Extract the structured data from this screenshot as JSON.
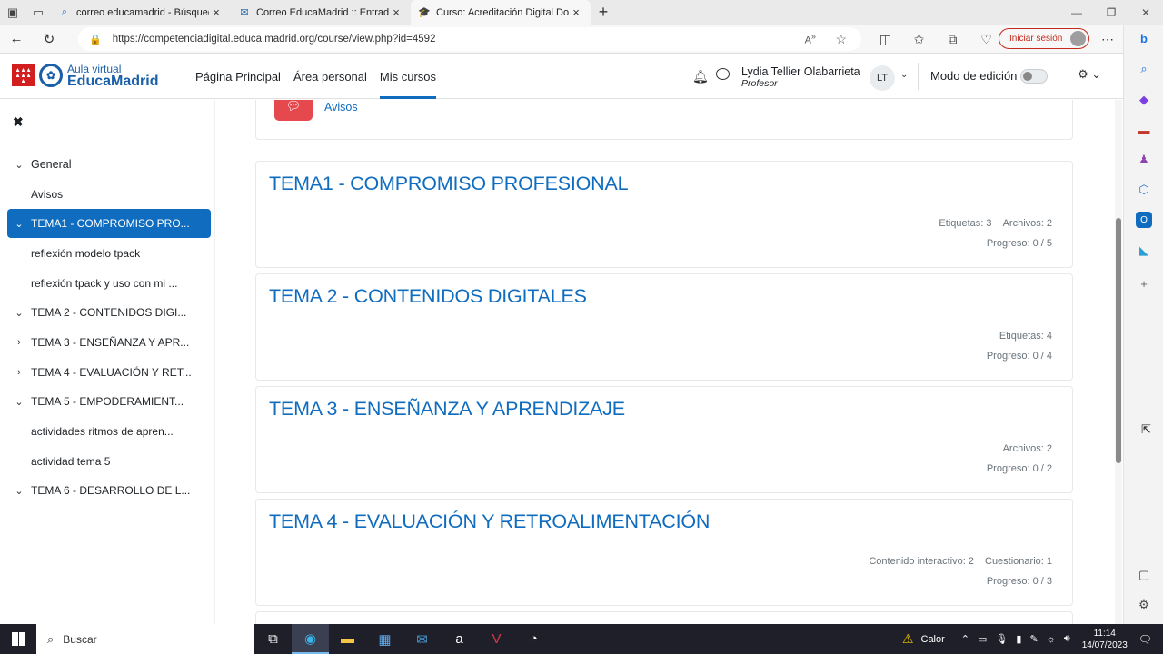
{
  "browser": {
    "tabs": [
      {
        "title": "correo educamadrid - Búsqueda",
        "icon": "search-icon",
        "active": false
      },
      {
        "title": "Correo EducaMadrid :: Entrada",
        "icon": "mail-icon",
        "active": false
      },
      {
        "title": "Curso: Acreditación Digital Doce",
        "icon": "graduation-cap-icon",
        "active": true
      }
    ],
    "url": "https://competenciadigital.educa.madrid.org/course/view.php?id=4592",
    "signin_label": "Iniciar sesión"
  },
  "site": {
    "logo_sub": "Aula virtual",
    "logo_main": "EducaMadrid",
    "nav": [
      {
        "label": "Página Principal",
        "active": false
      },
      {
        "label": "Área personal",
        "active": false
      },
      {
        "label": "Mis cursos",
        "active": true
      }
    ],
    "user": {
      "name": "Lydia Tellier Olabarrieta",
      "role": "Profesor",
      "initials": "LT"
    },
    "edit_mode_label": "Modo de edición"
  },
  "course_index": {
    "items": [
      {
        "label": "General",
        "type": "section",
        "expanded": true
      },
      {
        "label": "Avisos",
        "type": "activity"
      },
      {
        "label": "TEMA1 - COMPROMISO PRO...",
        "type": "section",
        "expanded": true,
        "active": true
      },
      {
        "label": "reflexión modelo tpack",
        "type": "activity"
      },
      {
        "label": "reflexión tpack y uso con mi ...",
        "type": "activity"
      },
      {
        "label": "TEMA 2 - CONTENIDOS DIGI...",
        "type": "section",
        "expanded": true
      },
      {
        "label": "TEMA 3 - ENSEÑANZA Y APR...",
        "type": "section",
        "expanded": false
      },
      {
        "label": "TEMA 4 - EVALUACIÓN Y RET...",
        "type": "section",
        "expanded": false
      },
      {
        "label": "TEMA 5 - EMPODERAMIENT...",
        "type": "section",
        "expanded": true
      },
      {
        "label": "actividades ritmos de apren...",
        "type": "activity"
      },
      {
        "label": "actividad tema 5",
        "type": "activity"
      },
      {
        "label": "TEMA 6 - DESARROLLO DE L...",
        "type": "section",
        "expanded": true
      }
    ]
  },
  "content": {
    "avisos_label": "Avisos",
    "sections": [
      {
        "title": "TEMA1 - COMPROMISO PROFESIONAL",
        "summary": [
          "Etiquetas: 3",
          "Archivos: 2"
        ],
        "progress": "Progreso: 0 / 5"
      },
      {
        "title": "TEMA 2 - CONTENIDOS DIGITALES",
        "summary": [
          "Etiquetas: 4"
        ],
        "progress": "Progreso: 0 / 4"
      },
      {
        "title": "TEMA 3 - ENSEÑANZA Y APRENDIZAJE",
        "summary": [
          "Archivos: 2"
        ],
        "progress": "Progreso: 0 / 2"
      },
      {
        "title": "TEMA 4 - EVALUACIÓN Y RETROALIMENTACIÓN",
        "summary": [
          "Contenido interactivo: 2",
          "Cuestionario: 1"
        ],
        "progress": "Progreso: 0 / 3"
      }
    ]
  },
  "taskbar": {
    "search_label": "Buscar",
    "weather": "Calor",
    "time": "11:14",
    "date": "14/07/2023"
  },
  "colors": {
    "accent": "#0f6cbf",
    "brand_red": "#d21e1e",
    "avisos_red": "#e5484d"
  }
}
